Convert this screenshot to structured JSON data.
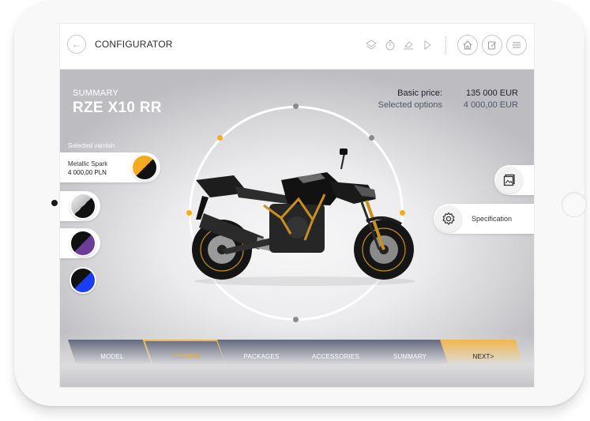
{
  "header": {
    "title": "CONFIGURATOR",
    "back_icon": "arrow-left-icon",
    "tools": [
      "layers-icon",
      "stopwatch-icon",
      "eraser-icon",
      "play-icon"
    ],
    "nav_buttons": [
      "home-icon",
      "edit-icon",
      "menu-icon"
    ]
  },
  "summary": {
    "label": "SUMMARY",
    "model": "RZE X10 RR"
  },
  "pricing": {
    "basic_label": "Basic price:",
    "basic_value": "135 000 EUR",
    "options_label": "Selected options",
    "options_value": "4 000,00 EUR"
  },
  "varnish": {
    "heading": "Selected varnish",
    "selected_name": "Metallic Spark",
    "selected_price": "4 000,00 PLN",
    "selected_color": "#f6ab1f",
    "options": [
      {
        "name": "silver",
        "color": "#d9d9dc"
      },
      {
        "name": "purple",
        "color": "#6a3d9a"
      },
      {
        "name": "blue",
        "color": "#1a3df5"
      }
    ]
  },
  "side_buttons": {
    "gallery_icon": "gallery-icon",
    "spec_label": "Specification",
    "spec_icon": "gear-icon"
  },
  "steps": [
    {
      "label": "MODEL",
      "state": "done"
    },
    {
      "label": "COLORS",
      "state": "active"
    },
    {
      "label": "PACKAGES",
      "state": "todo"
    },
    {
      "label": "ACCESSORIES",
      "state": "todo"
    },
    {
      "label": "SUMMARY",
      "state": "todo"
    },
    {
      "label": "NEXT>",
      "state": "next"
    }
  ],
  "colors": {
    "accent": "#f6ab1f",
    "step_bg": "#3e4560",
    "text_dark": "#1e1e2a"
  }
}
